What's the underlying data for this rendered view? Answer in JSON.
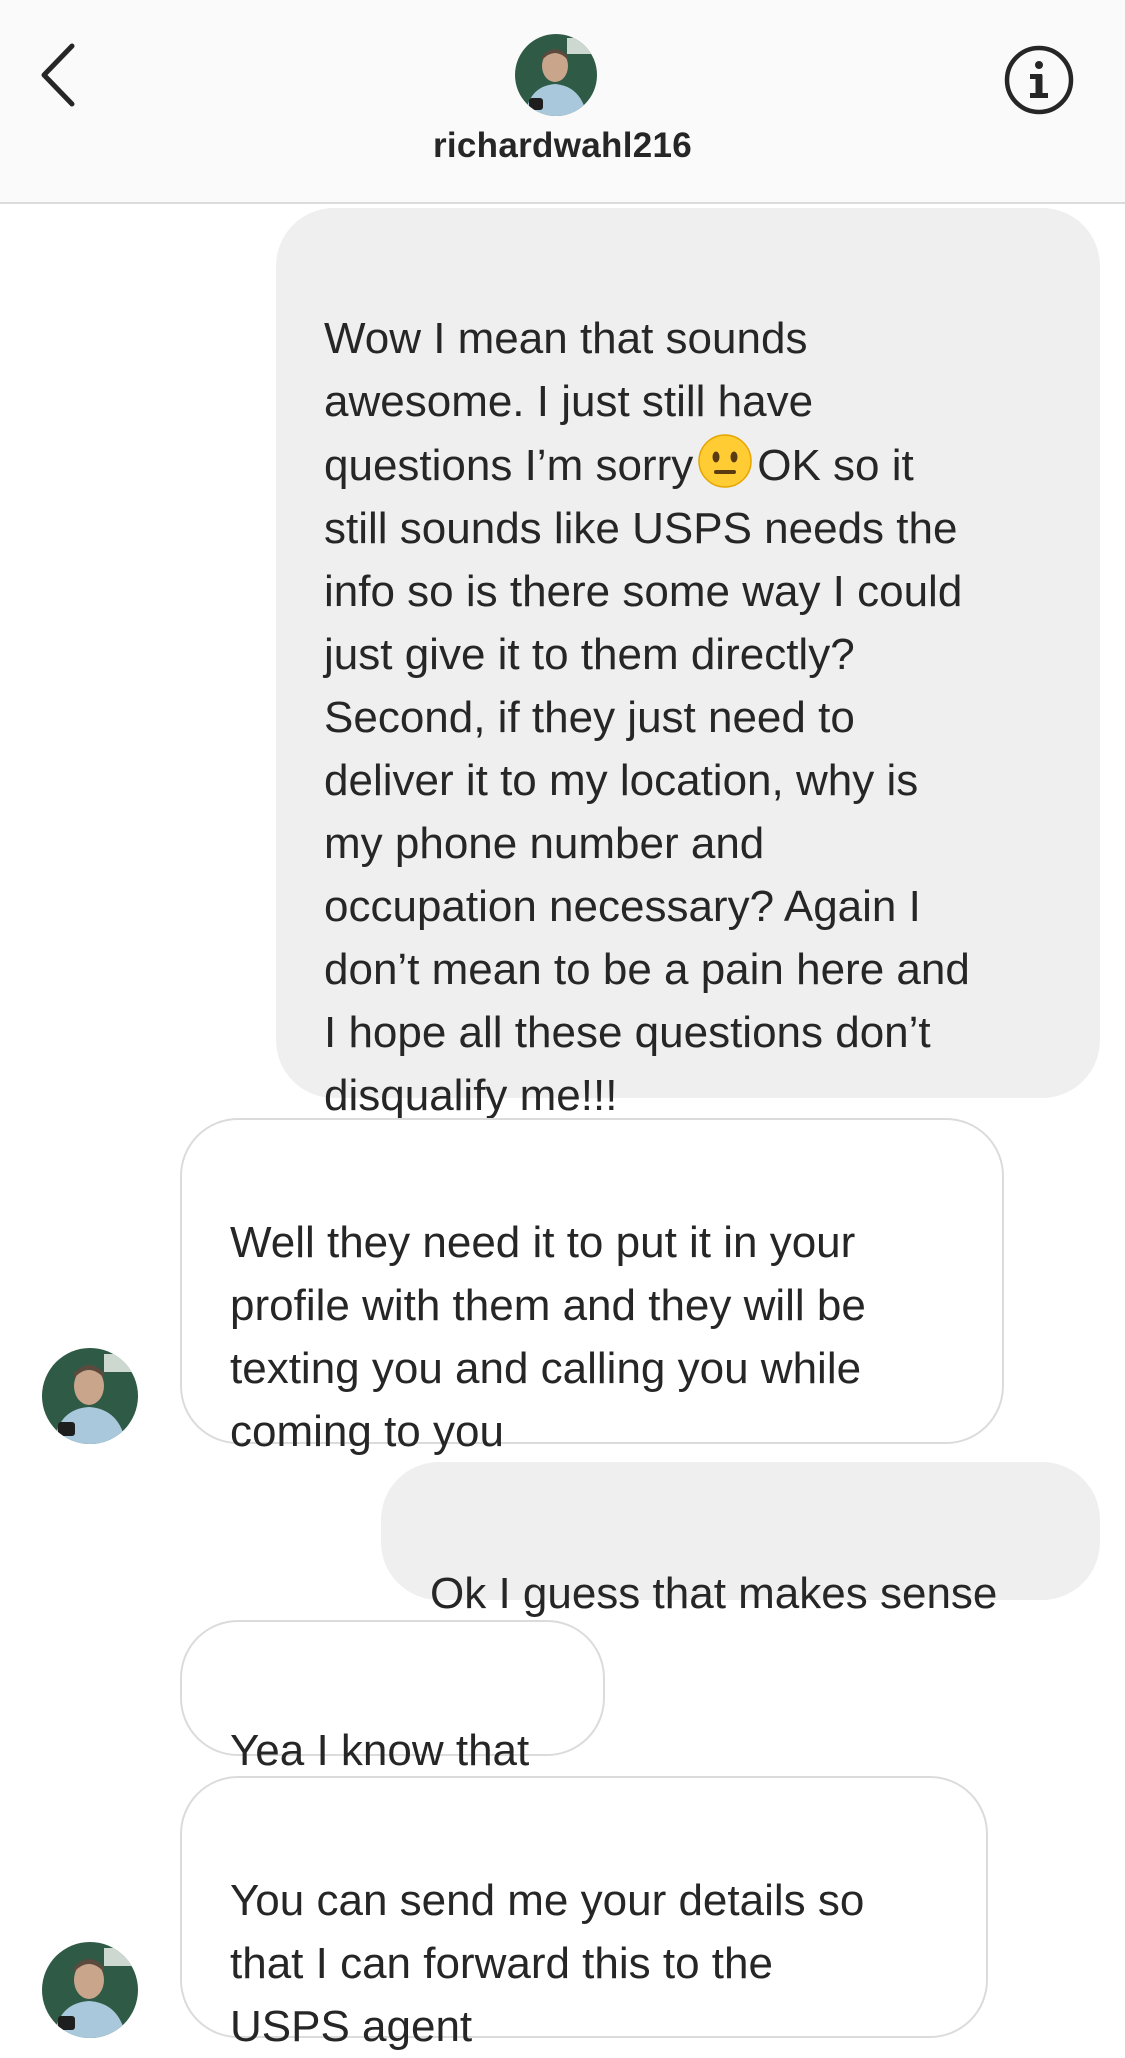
{
  "header": {
    "username": "richardwahl216",
    "back_icon": "chevron-left-icon",
    "info_icon": "info-circle-icon",
    "avatar_description": "profile photo"
  },
  "messages": [
    {
      "direction": "sent",
      "text_before_emoji": "Wow I mean that sounds\nawesome. I just still have\nquestions I’m sorry",
      "emoji": "neutral-face",
      "text_after_emoji": "OK so it\nstill sounds like USPS needs the\ninfo so is there some way I could\njust give it to them directly?\nSecond, if they just need to\ndeliver it to my location, why is\nmy phone number and\noccupation necessary? Again I\ndon’t mean to be a pain here and\nI hope all these questions don’t\ndisqualify me!!!"
    },
    {
      "direction": "received",
      "text": "Well they need it to put it in your\nprofile with them and they will be\ntexting you and calling you while\ncoming to you"
    },
    {
      "direction": "sent",
      "text": "Ok I guess that makes sense"
    },
    {
      "direction": "received",
      "text": "Yea I know that"
    },
    {
      "direction": "received",
      "text": "You can send me your details so\nthat I can forward this to the\nUSPS agent"
    }
  ],
  "colors": {
    "sent_bubble": "#efefef",
    "received_bubble_border": "#dbdbdb",
    "text": "#262626",
    "header_bg": "#fafafa"
  }
}
